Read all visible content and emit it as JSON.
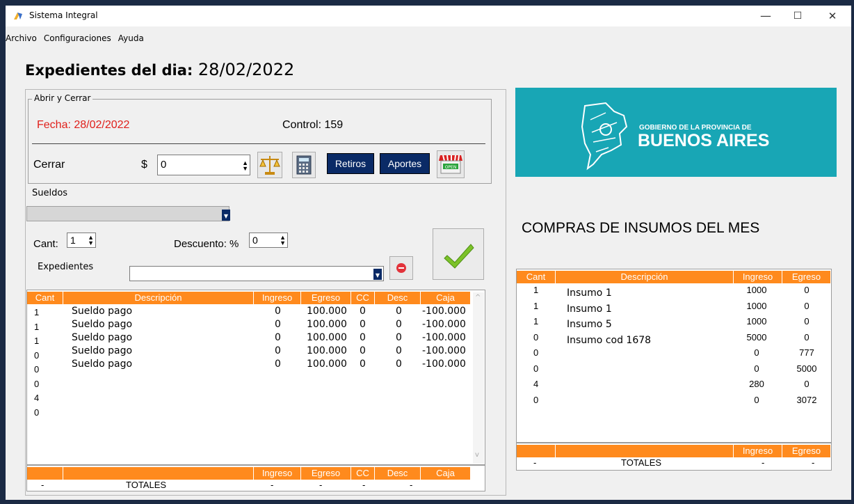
{
  "window": {
    "title": "Sistema Integral",
    "minimize": "—",
    "maximize": "☐",
    "close": "✕"
  },
  "menu": [
    "Archivo",
    "Configuraciones",
    "Ayuda"
  ],
  "heading": {
    "label": "Expedientes del dia:",
    "date": "28/02/2022"
  },
  "abrir_cerrar": {
    "legend": "Abrir y Cerrar",
    "fecha": "Fecha: 28/02/2022",
    "control": "Control: 159",
    "cerrar_label": "Cerrar",
    "currency": "$",
    "amount": "0",
    "retiros": "Retiros",
    "aportes": "Aportes",
    "open_sign": "OPEN"
  },
  "sueldos": {
    "label": "Sueldos"
  },
  "cant": {
    "label": "Cant:",
    "value": "1"
  },
  "descuento": {
    "label": "Descuento: %",
    "value": "0"
  },
  "expedientes": {
    "label": "Expedientes"
  },
  "main_table": {
    "headers": [
      "Cant",
      "Descripción",
      "Ingreso",
      "Egreso",
      "CC",
      "Desc",
      "Caja"
    ],
    "cant_column": [
      "1",
      "1",
      "1",
      "0",
      "0",
      "0",
      "4",
      "0"
    ],
    "rows": [
      {
        "desc": "Sueldo pago",
        "ingreso": "0",
        "egreso": "100.000",
        "cc": "0",
        "descv": "0",
        "caja": "-100.000"
      },
      {
        "desc": "Sueldo pago",
        "ingreso": "0",
        "egreso": "100.000",
        "cc": "0",
        "descv": "0",
        "caja": "-100.000"
      },
      {
        "desc": "Sueldo pago",
        "ingreso": "0",
        "egreso": "100.000",
        "cc": "0",
        "descv": "0",
        "caja": "-100.000"
      },
      {
        "desc": "Sueldo pago",
        "ingreso": "0",
        "egreso": "100.000",
        "cc": "0",
        "descv": "0",
        "caja": "-100.000"
      },
      {
        "desc": "Sueldo pago",
        "ingreso": "0",
        "egreso": "100.000",
        "cc": "0",
        "descv": "0",
        "caja": "-100.000"
      }
    ]
  },
  "main_totals": {
    "headers": [
      "",
      "",
      "Ingreso",
      "Egreso",
      "CC",
      "Desc",
      "Caja"
    ],
    "values": [
      "-",
      "TOTALES",
      "-",
      "-",
      "-",
      "-",
      ""
    ]
  },
  "banner": {
    "line1": "GOBIERNO DE LA PROVINCIA DE",
    "line2": "BUENOS AIRES"
  },
  "compras_title": "COMPRAS DE INSUMOS DEL MES",
  "compras_table": {
    "headers": [
      "Cant",
      "Descripción",
      "Ingreso",
      "Egreso"
    ],
    "rows": [
      {
        "cant": "1",
        "desc": "Insumo 1",
        "ingreso": "1000",
        "egreso": "0"
      },
      {
        "cant": "1",
        "desc": "Insumo 1",
        "ingreso": "1000",
        "egreso": "0"
      },
      {
        "cant": "1",
        "desc": "Insumo 5",
        "ingreso": "1000",
        "egreso": "0"
      },
      {
        "cant": "0",
        "desc": "Insumo  cod 1678",
        "ingreso": "5000",
        "egreso": "0"
      },
      {
        "cant": "0",
        "desc": "",
        "ingreso": "0",
        "egreso": "777"
      },
      {
        "cant": "0",
        "desc": "",
        "ingreso": "0",
        "egreso": "5000"
      },
      {
        "cant": "4",
        "desc": "",
        "ingreso": "280",
        "egreso": "0"
      },
      {
        "cant": "0",
        "desc": "",
        "ingreso": "0",
        "egreso": "3072"
      }
    ]
  },
  "compras_totals": {
    "headers": [
      "",
      "",
      "Ingreso",
      "Egreso"
    ],
    "values": [
      "-",
      "TOTALES",
      "-",
      "-"
    ]
  },
  "colors": {
    "orange": "#ff8a1d",
    "navy": "#0a2a66",
    "red_text": "#e0201b",
    "banner": "#18a6b5"
  }
}
